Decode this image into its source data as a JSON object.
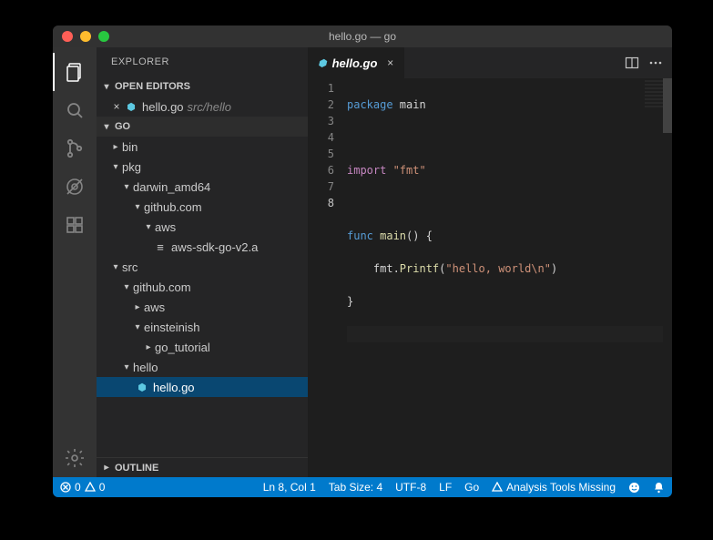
{
  "window": {
    "title": "hello.go — go"
  },
  "traffic": {
    "close": "#ff5f57",
    "min": "#febc2e",
    "max": "#28c840"
  },
  "activity": [
    {
      "name": "explorer-icon",
      "active": true
    },
    {
      "name": "search-icon",
      "active": false
    },
    {
      "name": "scm-icon",
      "active": false
    },
    {
      "name": "debug-icon",
      "active": false
    },
    {
      "name": "extensions-icon",
      "active": false
    }
  ],
  "sidebar": {
    "title": "EXPLORER",
    "sections": {
      "openEditors": {
        "label": "OPEN EDITORS"
      },
      "workspace": {
        "label": "GO"
      },
      "outline": {
        "label": "OUTLINE"
      }
    },
    "openEditors": [
      {
        "name": "hello.go",
        "hint": "src/hello"
      }
    ],
    "tree": {
      "bin": {
        "label": "bin"
      },
      "pkg": {
        "label": "pkg"
      },
      "darwin": {
        "label": "darwin_amd64"
      },
      "gh1": {
        "label": "github.com"
      },
      "aws1": {
        "label": "aws"
      },
      "awsSdk": {
        "label": "aws-sdk-go-v2.a"
      },
      "src": {
        "label": "src"
      },
      "gh2": {
        "label": "github.com"
      },
      "aws2": {
        "label": "aws"
      },
      "einst": {
        "label": "einsteinish"
      },
      "gotut": {
        "label": "go_tutorial"
      },
      "hello": {
        "label": "hello"
      },
      "helloGo": {
        "label": "hello.go"
      }
    }
  },
  "editor": {
    "tab": {
      "label": "hello.go"
    },
    "lines": [
      "1",
      "2",
      "3",
      "4",
      "5",
      "6",
      "7",
      "8"
    ],
    "code": {
      "l1a": "package",
      "l1b": " main",
      "l3a": "import",
      "l3b": " \"fmt\"",
      "l5a": "func",
      "l5b": " main",
      "l5c": "() {",
      "l6a": "    fmt.",
      "l6b": "Printf",
      "l6c": "(",
      "l6d": "\"hello, world\\n\"",
      "l6e": ")",
      "l7": "}"
    }
  },
  "status": {
    "errors": "0",
    "warnings": "0",
    "lncol": "Ln 8, Col 1",
    "tab": "Tab Size: 4",
    "enc": "UTF-8",
    "eol": "LF",
    "lang": "Go",
    "analysis": "Analysis Tools Missing"
  }
}
